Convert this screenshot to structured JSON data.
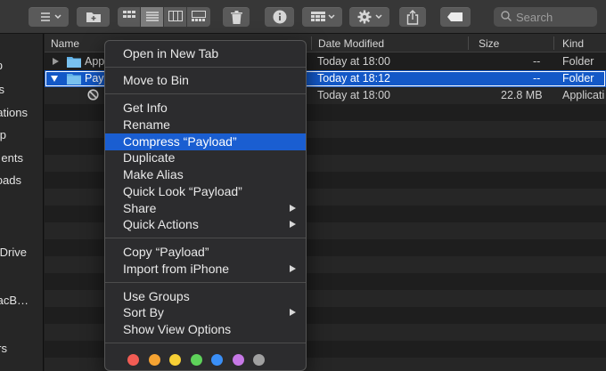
{
  "toolbar": {
    "search_placeholder": "Search",
    "icons": [
      "back-forward-icon",
      "new-folder-icon",
      "icon-view-icon",
      "list-view-icon",
      "column-view-icon",
      "gallery-view-icon",
      "trash-icon",
      "info-icon",
      "group-icon",
      "gear-icon",
      "share-icon",
      "tag-icon",
      "search-icon"
    ]
  },
  "sidebar": {
    "items": [
      "p",
      "s",
      "ations",
      "p",
      "ents",
      "oads",
      "Drive",
      "acB…",
      "rs"
    ]
  },
  "table": {
    "headers": {
      "name": "Name",
      "date": "Date Modified",
      "size": "Size",
      "kind": "Kind"
    },
    "rows": [
      {
        "name": "App",
        "date": "Today at 18:00",
        "size": "--",
        "kind": "Folder"
      },
      {
        "name": "Pay",
        "date": "Today at 18:12",
        "size": "--",
        "kind": "Folder"
      },
      {
        "name": "",
        "date": "Today at 18:00",
        "size": "22.8 MB",
        "kind": "Applicati"
      }
    ]
  },
  "menu": {
    "open_new_tab": "Open in New Tab",
    "move_to_bin": "Move to Bin",
    "get_info": "Get Info",
    "rename": "Rename",
    "compress": "Compress “Payload”",
    "duplicate": "Duplicate",
    "make_alias": "Make Alias",
    "quick_look": "Quick Look “Payload”",
    "share": "Share",
    "quick_actions": "Quick Actions",
    "copy": "Copy “Payload”",
    "import_iphone": "Import from iPhone",
    "use_groups": "Use Groups",
    "sort_by": "Sort By",
    "show_view_options": "Show View Options",
    "tag_colors": [
      "#f25c54",
      "#f5a332",
      "#f7cf35",
      "#5ed25a",
      "#3a8ff7",
      "#c678e6",
      "#a0a0a0"
    ]
  },
  "colors": {
    "selection": "#1358c7",
    "menu_highlight": "#1a5ed1",
    "folder": "#5fb0e6"
  }
}
